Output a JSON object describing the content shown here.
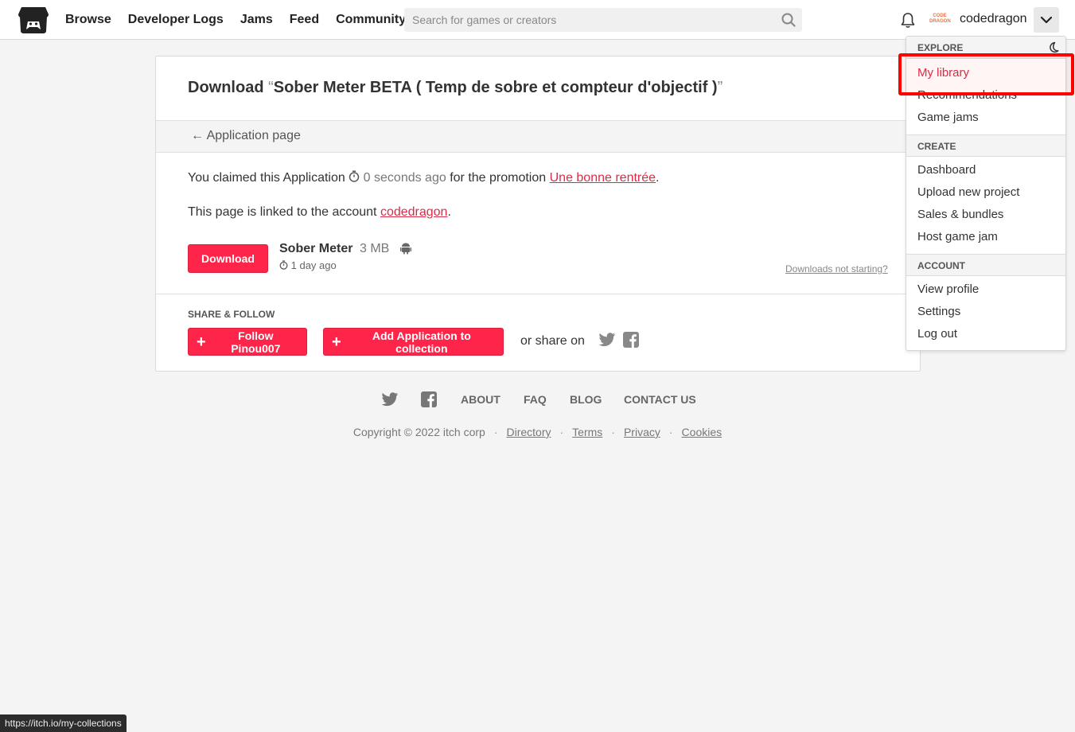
{
  "header": {
    "logo_icon": "itch-storefront-icon",
    "nav": [
      "Browse",
      "Developer Logs",
      "Jams",
      "Feed",
      "Community"
    ],
    "search_placeholder": "Search for games or creators",
    "avatar_text": "CODE DRAGON",
    "username": "codedragon"
  },
  "page": {
    "title_prefix": "Download ",
    "title_open_quote": "“",
    "title_name": "Sober Meter BETA ( Temp de sobre et compteur d'objectif )",
    "title_close_quote": "”",
    "back_link": "← Application page",
    "claim_prefix": "You claimed this Application",
    "claim_time": "0 seconds ago",
    "claim_mid": "for the promotion",
    "promotion_name": "Une bonne rentrée",
    "period": ".",
    "linked_prefix": "This page is linked to the account",
    "linked_account": "codedragon",
    "download_label": "Download",
    "upload_name": "Sober Meter",
    "upload_size": "3 MB",
    "upload_date": "1 day ago",
    "downloads_not_starting": "Downloads not starting?",
    "share_title": "SHARE & FOLLOW",
    "follow_label": "Follow Pinou007",
    "collection_label": "Add Application to collection",
    "or_share": "or share on"
  },
  "footer": {
    "links": [
      "ABOUT",
      "FAQ",
      "BLOG",
      "CONTACT US"
    ],
    "copyright": "Copyright © 2022 itch corp",
    "legal": [
      "Directory",
      "Terms",
      "Privacy",
      "Cookies"
    ]
  },
  "dropdown": {
    "explore_header": "EXPLORE",
    "explore_items": [
      "My library",
      "Recommendations",
      "Game jams"
    ],
    "create_header": "CREATE",
    "create_items": [
      "Dashboard",
      "Upload new project",
      "Sales & bundles",
      "Host game jam"
    ],
    "account_header": "ACCOUNT",
    "account_items": [
      "View profile",
      "Settings",
      "Log out"
    ]
  },
  "status_bar_url": "https://itch.io/my-collections",
  "colors": {
    "accent_red": "#ff2449",
    "link_red": "#da2c48",
    "highlight_red": "#ff0000"
  }
}
